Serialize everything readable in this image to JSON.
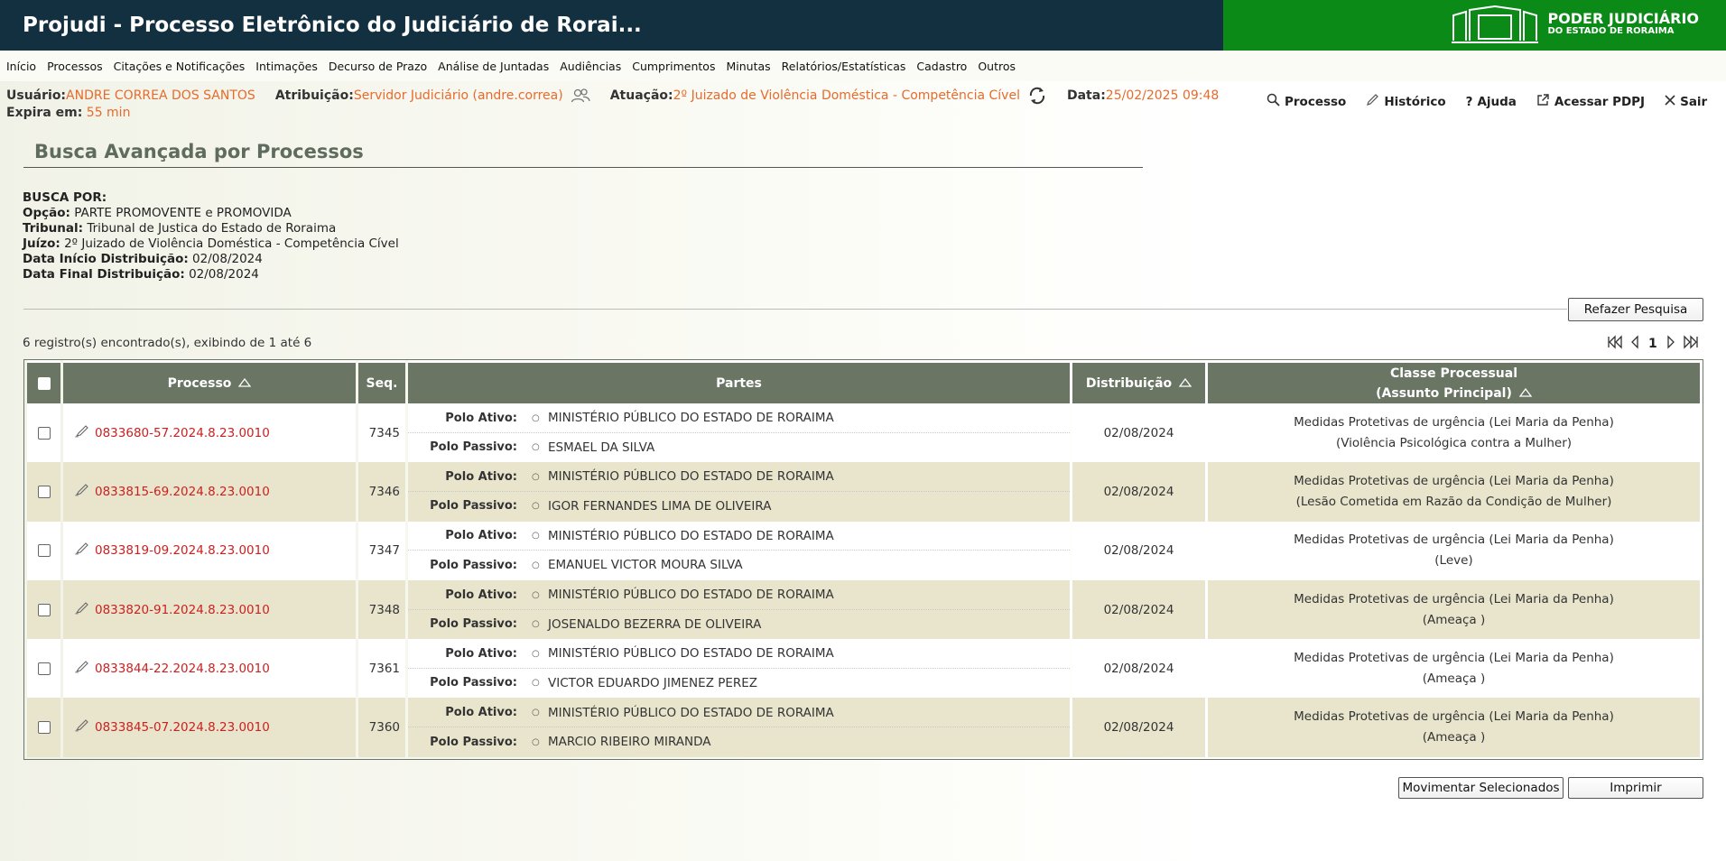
{
  "header": {
    "title": "Projudi - Processo Eletrônico do Judiciário de Rorai...",
    "logo_line1": "PODER JUDICIÁRIO",
    "logo_line2": "DO ESTADO DE RORAIMA",
    "title_bg": "#133040",
    "logo_bg": "#0c8a18"
  },
  "menu": [
    "Início",
    "Processos",
    "Citações e Notificações",
    "Intimações",
    "Decurso de Prazo",
    "Análise de Juntadas",
    "Audiências",
    "Cumprimentos",
    "Minutas",
    "Relatórios/Estatísticas",
    "Cadastro",
    "Outros"
  ],
  "user": {
    "usuario_label": "Usuário:",
    "usuario": "ANDRE CORREA DOS SANTOS",
    "atribuicao_label": "Atribuição:",
    "atribuicao": "Servidor Judiciário (andre.correa)",
    "atuacao_label": "Atuação:",
    "atuacao": "2º Juizado de Violência Doméstica - Competência Cível",
    "data_label": "Data:",
    "data": "25/02/2025 09:48",
    "expira_label": "Expira em:",
    "expira": "55 min",
    "accent": "#e66b2c"
  },
  "quicklinks": {
    "processo": "Processo",
    "historico": "Histórico",
    "ajuda": "Ajuda",
    "pdpj": "Acessar PDPJ",
    "sair": "Sair"
  },
  "page": {
    "title": "Busca Avançada por Processos",
    "criteria_header": "BUSCA POR:",
    "criteria": [
      {
        "label": "Opção:",
        "value": "PARTE PROMOVENTE e PROMOVIDA"
      },
      {
        "label": "Tribunal:",
        "value": "Tribunal de Justica do Estado de Roraima"
      },
      {
        "label": "Juízo:",
        "value": "2º Juizado de Violência Doméstica - Competência Cível"
      },
      {
        "label": "Data Início Distribuição:",
        "value": "02/08/2024"
      },
      {
        "label": "Data Final Distribuição:",
        "value": "02/08/2024"
      }
    ],
    "refazer": "Refazer Pesquisa",
    "record_count": "6 registro(s) encontrado(s), exibindo de 1 até 6",
    "current_page": "1",
    "mov_btn": "Movimentar Selecionados",
    "print_btn": "Imprimir"
  },
  "table": {
    "headers": {
      "processo": "Processo",
      "seq": "Seq.",
      "partes": "Partes",
      "distribuicao": "Distribuição",
      "classe_l1": "Classe Processual",
      "classe_l2": "(Assunto Principal)"
    },
    "polo_ativo_label": "Polo Ativo:",
    "polo_passivo_label": "Polo Passivo:",
    "rows": [
      {
        "processo": "0833680-57.2024.8.23.0010",
        "seq": "7345",
        "ativo": "MINISTÉRIO PÚBLICO DO ESTADO DE RORAIMA",
        "passivo": "ESMAEL DA SILVA",
        "distribuicao": "02/08/2024",
        "classe": "Medidas Protetivas de urgência (Lei Maria da Penha)",
        "assunto": "(Violência Psicológica contra a Mulher)"
      },
      {
        "processo": "0833815-69.2024.8.23.0010",
        "seq": "7346",
        "ativo": "MINISTÉRIO PÚBLICO DO ESTADO DE RORAIMA",
        "passivo": "IGOR FERNANDES LIMA DE OLIVEIRA",
        "distribuicao": "02/08/2024",
        "classe": "Medidas Protetivas de urgência (Lei Maria da Penha)",
        "assunto": "(Lesão Cometida em Razão da Condição de Mulher)"
      },
      {
        "processo": "0833819-09.2024.8.23.0010",
        "seq": "7347",
        "ativo": "MINISTÉRIO PÚBLICO DO ESTADO DE RORAIMA",
        "passivo": "EMANUEL VICTOR MOURA SILVA",
        "distribuicao": "02/08/2024",
        "classe": "Medidas Protetivas de urgência (Lei Maria da Penha)",
        "assunto": "(Leve)"
      },
      {
        "processo": "0833820-91.2024.8.23.0010",
        "seq": "7348",
        "ativo": "MINISTÉRIO PÚBLICO DO ESTADO DE RORAIMA",
        "passivo": "JOSENALDO BEZERRA DE OLIVEIRA",
        "distribuicao": "02/08/2024",
        "classe": "Medidas Protetivas de urgência (Lei Maria da Penha)",
        "assunto": "(Ameaça )"
      },
      {
        "processo": "0833844-22.2024.8.23.0010",
        "seq": "7361",
        "ativo": "MINISTÉRIO PÚBLICO DO ESTADO DE RORAIMA",
        "passivo": "VICTOR EDUARDO JIMENEZ PEREZ",
        "distribuicao": "02/08/2024",
        "classe": "Medidas Protetivas de urgência (Lei Maria da Penha)",
        "assunto": "(Ameaça )"
      },
      {
        "processo": "0833845-07.2024.8.23.0010",
        "seq": "7360",
        "ativo": "MINISTÉRIO PÚBLICO DO ESTADO DE RORAIMA",
        "passivo": "MARCIO RIBEIRO MIRANDA",
        "distribuicao": "02/08/2024",
        "classe": "Medidas Protetivas de urgência (Lei Maria da Penha)",
        "assunto": "(Ameaça )"
      }
    ]
  },
  "icons": {
    "refresh": "refresh-icon",
    "users": "users-icon",
    "search": "search-icon",
    "edit": "pencil-icon",
    "help": "help-icon",
    "external": "external-link-icon",
    "close": "close-icon"
  }
}
